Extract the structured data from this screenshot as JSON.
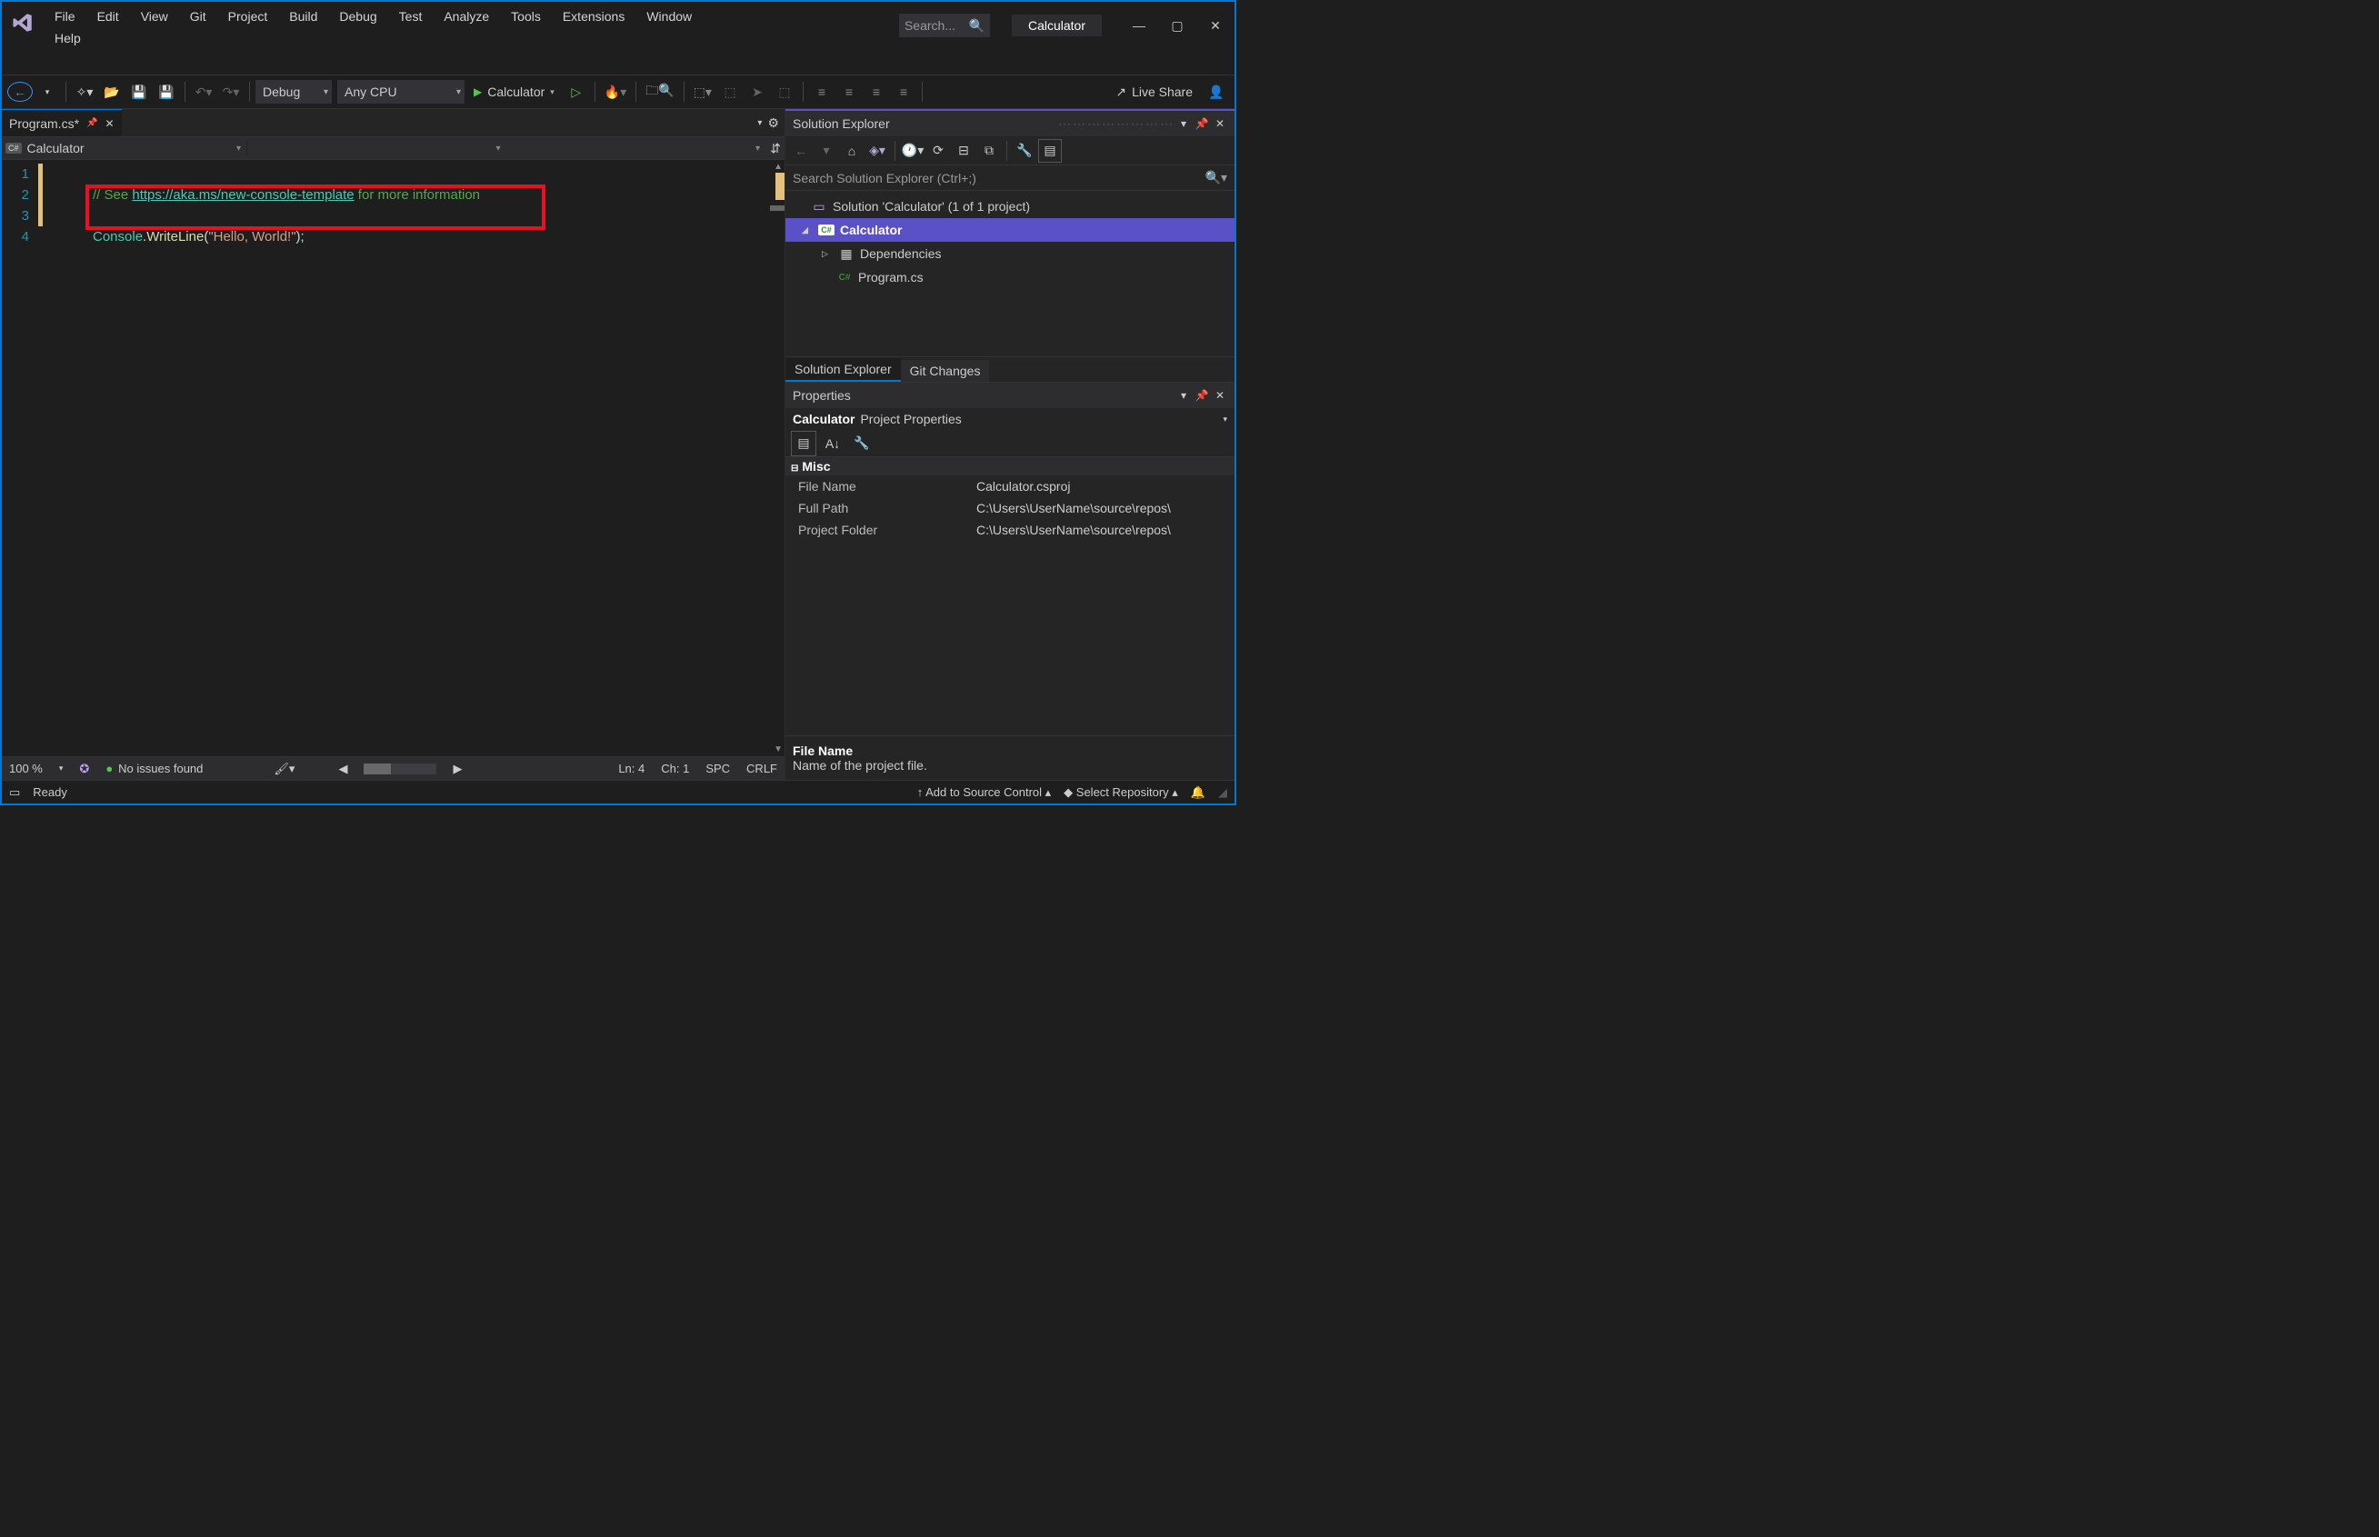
{
  "app": {
    "title": "Calculator",
    "search_placeholder": "Search..."
  },
  "menus": [
    "File",
    "Edit",
    "View",
    "Git",
    "Project",
    "Build",
    "Debug",
    "Test",
    "Analyze",
    "Tools",
    "Extensions",
    "Window",
    "Help"
  ],
  "toolbar": {
    "config": "Debug",
    "platform": "Any CPU",
    "start_target": "Calculator",
    "live_share": "Live Share"
  },
  "tab": {
    "name": "Program.cs*"
  },
  "nav": {
    "context": "Calculator"
  },
  "code": {
    "comment_prefix": "// See ",
    "link": "https://aka.ms/new-console-template",
    "comment_suffix": " for more information",
    "class": "Console",
    "method": "WriteLine",
    "string": "\"Hello, World!\"",
    "line_numbers": [
      "1",
      "2",
      "3",
      "4"
    ]
  },
  "editor_footer": {
    "zoom": "100 %",
    "issues": "No issues found",
    "ln": "Ln: 4",
    "ch": "Ch: 1",
    "spc": "SPC",
    "crlf": "CRLF"
  },
  "solution_explorer": {
    "title": "Solution Explorer",
    "search_placeholder": "Search Solution Explorer (Ctrl+;)",
    "solution": "Solution 'Calculator' (1 of 1 project)",
    "project": "Calculator",
    "deps": "Dependencies",
    "file": "Program.cs",
    "tabs": [
      "Solution Explorer",
      "Git Changes"
    ]
  },
  "properties": {
    "title": "Properties",
    "subject": "Calculator",
    "subject_kind": "Project Properties",
    "category": "Misc",
    "rows": [
      {
        "k": "File Name",
        "v": "Calculator.csproj"
      },
      {
        "k": "Full Path",
        "v": "C:\\Users\\UserName\\source\\repos\\"
      },
      {
        "k": "Project Folder",
        "v": "C:\\Users\\UserName\\source\\repos\\"
      }
    ],
    "desc_title": "File Name",
    "desc_text": "Name of the project file."
  },
  "status": {
    "ready": "Ready",
    "add_source": "Add to Source Control",
    "select_repo": "Select Repository"
  }
}
